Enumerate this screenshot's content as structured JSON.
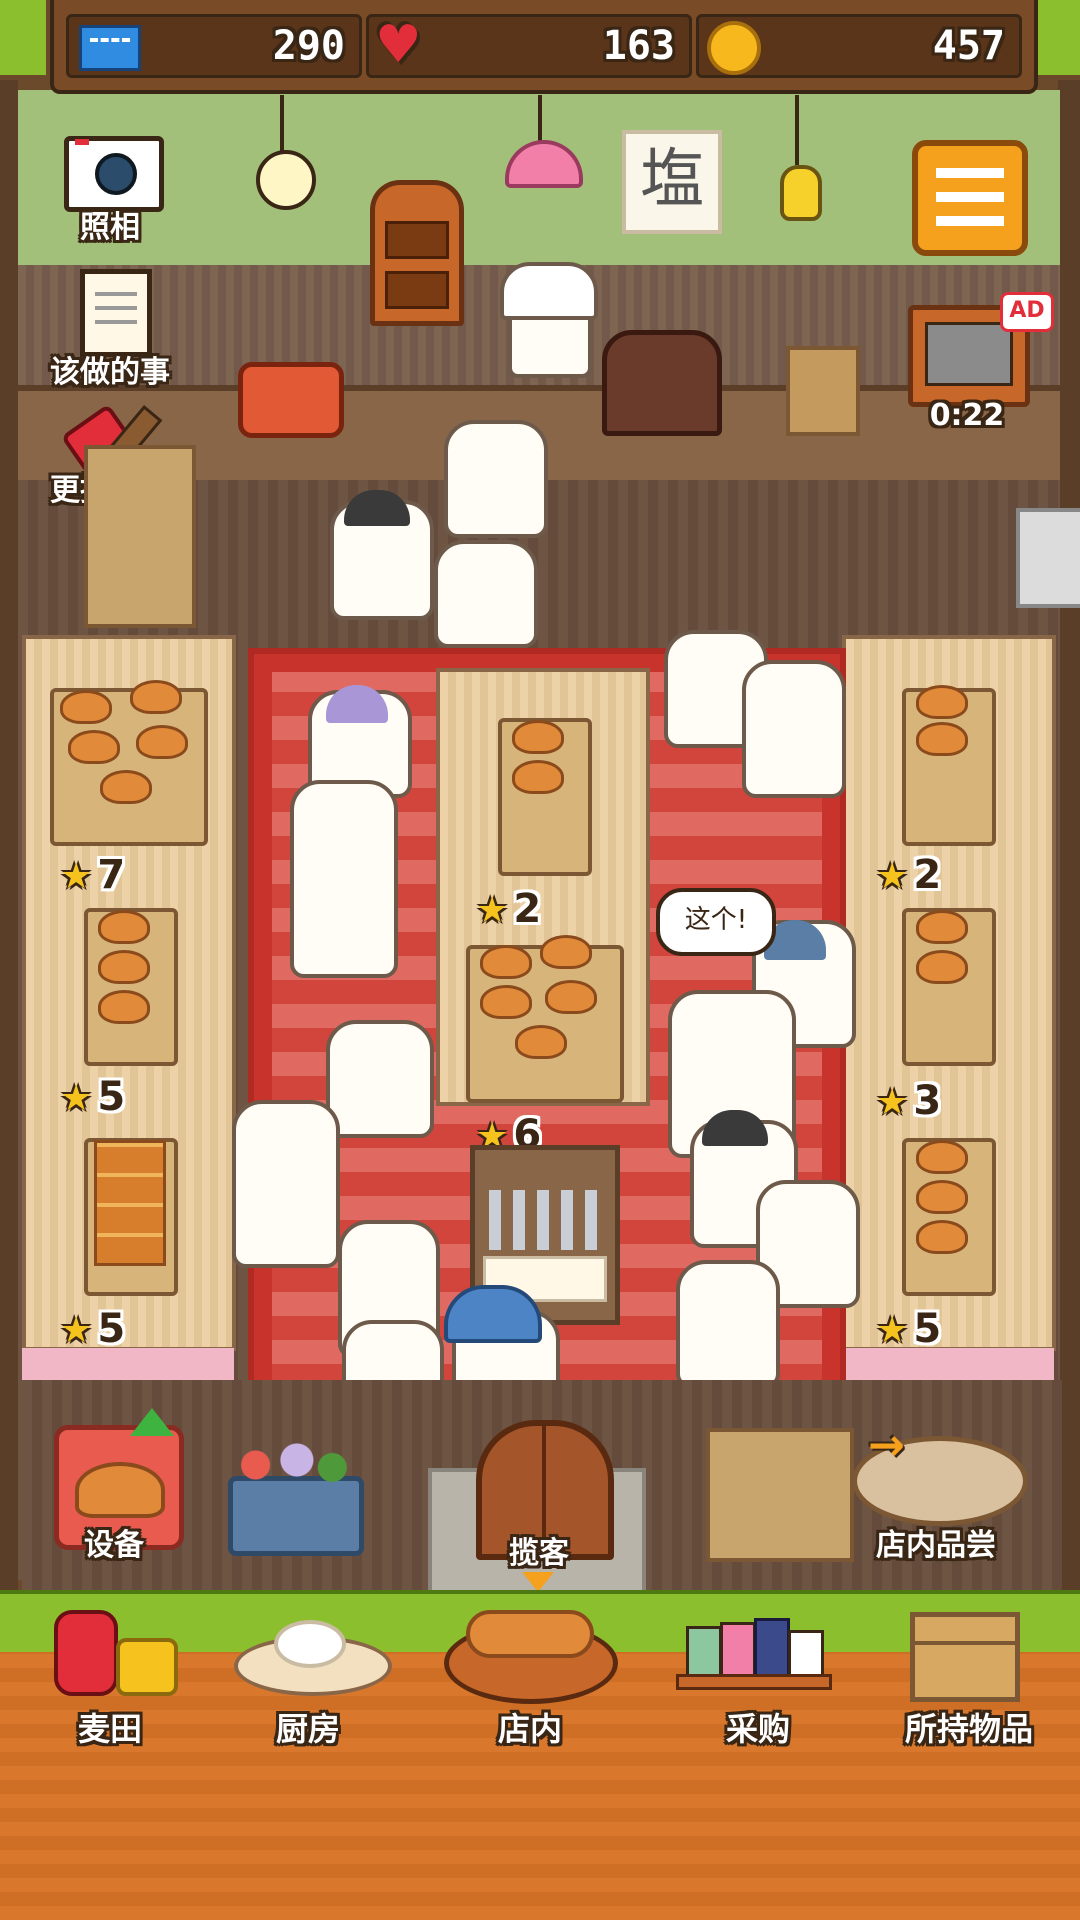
{
  "resources": {
    "tickets": "290",
    "hearts": "163",
    "coins": "457"
  },
  "left_menu": {
    "camera": "照相",
    "todo": "该做的事",
    "decorate": "更换装饰"
  },
  "sign": "塩",
  "ad": {
    "badge": "AD",
    "timer": "0:22"
  },
  "speech_bubble": "这个!",
  "shelves": {
    "left_top": "7",
    "left_mid": "5",
    "left_bot": "5",
    "center_top": "2",
    "center_mid": "6",
    "right_top": "2",
    "right_mid": "3",
    "right_bot": "5"
  },
  "floor_actions": {
    "equipment": "设备",
    "attract": "揽客",
    "tasting": "店内品尝"
  },
  "nav": {
    "field": "麦田",
    "kitchen": "厨房",
    "store": "店内",
    "purchase": "采购",
    "inventory": "所持物品"
  },
  "colors": {
    "grass": "#8cbf2e",
    "wood": "#d9782c",
    "accent": "#f6a11d",
    "rug": "#c8332c"
  }
}
